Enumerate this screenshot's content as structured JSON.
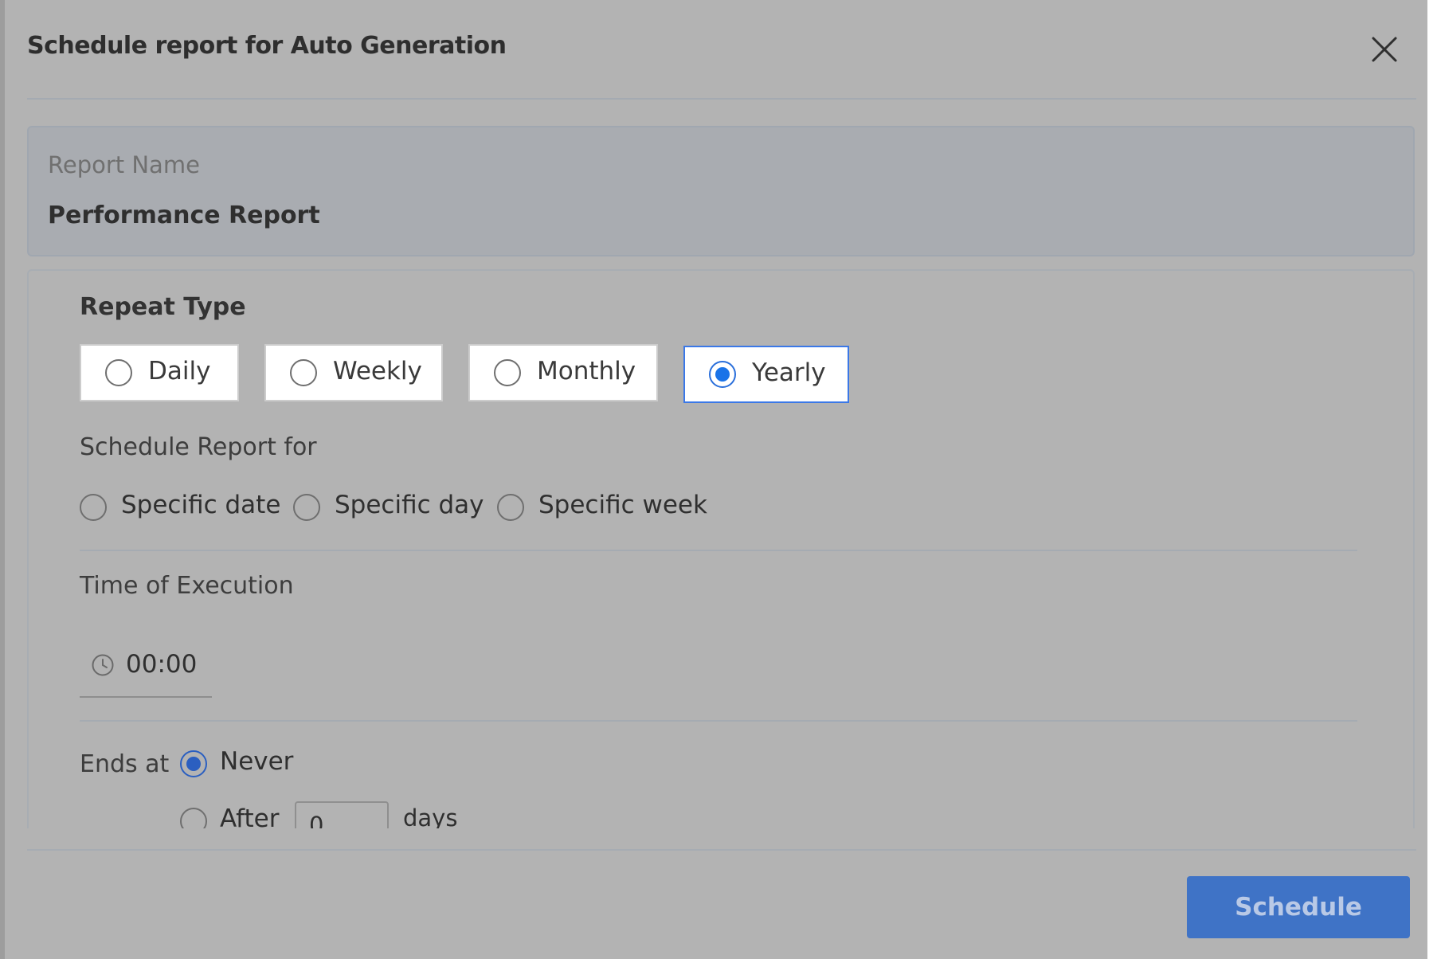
{
  "dialog": {
    "title": "Schedule report for Auto Generation",
    "close_icon": "close-icon"
  },
  "report_name": {
    "label": "Report Name",
    "value": "Performance Report"
  },
  "repeat_type": {
    "heading": "Repeat Type",
    "options": [
      {
        "label": "Daily",
        "selected": false
      },
      {
        "label": "Weekly",
        "selected": false
      },
      {
        "label": "Monthly",
        "selected": false
      },
      {
        "label": "Yearly",
        "selected": true
      }
    ],
    "selected_color": "#1a73e8"
  },
  "schedule_for": {
    "heading": "Schedule Report for",
    "options": [
      {
        "label": "Specific date",
        "selected": false
      },
      {
        "label": "Specific day",
        "selected": false
      },
      {
        "label": "Specific week",
        "selected": false
      }
    ]
  },
  "time_of_execution": {
    "heading": "Time of Execution",
    "icon": "clock-icon",
    "value": "00:00"
  },
  "ends_at": {
    "label": "Ends at",
    "never_label": "Never",
    "never_selected": true,
    "after_label": "After",
    "after_value": "0",
    "days_label": "days"
  },
  "footer": {
    "schedule_label": "Schedule",
    "accent": "#3f73c6"
  }
}
